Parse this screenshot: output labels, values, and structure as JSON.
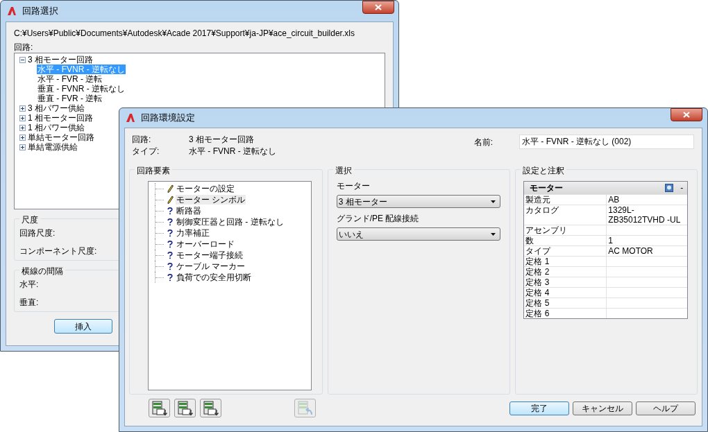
{
  "back_window": {
    "title": "回路選択",
    "path": "C:¥Users¥Public¥Documents¥Autodesk¥Acade 2017¥Support¥ja-JP¥ace_circuit_builder.xls",
    "tree_label": "回路:",
    "tree": [
      {
        "label": "3 相モーター回路",
        "expanded": true,
        "selected": false,
        "children": [
          {
            "label": "水平 - FVNR - 逆転なし",
            "selected": true
          },
          {
            "label": "水平 - FVR - 逆転",
            "selected": false
          },
          {
            "label": "垂直 - FVNR - 逆転なし",
            "selected": false
          },
          {
            "label": "垂直 - FVR - 逆転",
            "selected": false
          }
        ]
      },
      {
        "label": "3 相パワー供給",
        "expanded": false,
        "selected": false
      },
      {
        "label": "1 相モーター回路",
        "expanded": false,
        "selected": false
      },
      {
        "label": "1 相パワー供給",
        "expanded": false,
        "selected": false
      },
      {
        "label": "単結モーター回路",
        "expanded": false,
        "selected": false
      },
      {
        "label": "単結電源供給",
        "expanded": false,
        "selected": false
      }
    ],
    "groups": [
      {
        "title": "尺度",
        "labels": [
          "回路尺度:",
          "コンポーネント尺度:"
        ]
      },
      {
        "title": "横線の間隔",
        "labels": [
          "水平:",
          "垂直:"
        ]
      }
    ],
    "insert_button": "挿入"
  },
  "front_window": {
    "title": "回路環境設定",
    "info": [
      {
        "label": "回路:",
        "value": "3 相モーター回路"
      },
      {
        "label": "タイプ:",
        "value": "水平 - FVNR - 逆転なし"
      }
    ],
    "name_label": "名前:",
    "name_value": "水平 - FVNR - 逆転なし (002)",
    "elements_group": {
      "title": "回路要素",
      "items": [
        {
          "label": "モーターの設定",
          "kind": "pencil",
          "selected": false
        },
        {
          "label": "モーター シンボル",
          "kind": "pencil",
          "selected": true
        },
        {
          "label": "断路器",
          "kind": "question",
          "selected": false
        },
        {
          "label": "制御変圧器と回路 - 逆転なし",
          "kind": "question",
          "selected": false
        },
        {
          "label": "力率補正",
          "kind": "question",
          "selected": false
        },
        {
          "label": "オーバーロード",
          "kind": "question",
          "selected": false
        },
        {
          "label": "モーター端子接続",
          "kind": "question",
          "selected": false
        },
        {
          "label": "ケーブル マーカー",
          "kind": "question",
          "selected": false
        },
        {
          "label": "負荷での安全用切断",
          "kind": "question",
          "selected": false
        }
      ]
    },
    "selection_group": {
      "title": "選択",
      "fields": [
        {
          "label": "モーター",
          "value": "3 相モーター"
        },
        {
          "label": "グランド/PE 配線接続",
          "value": "いいえ"
        }
      ]
    },
    "settings_group": {
      "title": "設定と注釈",
      "grid_title": "モーター",
      "collapse": "-",
      "rows": [
        {
          "name": "製造元",
          "value": "AB"
        },
        {
          "name": "カタログ",
          "value": "1329L-ZB35012TVHD -UL"
        },
        {
          "name": "アセンブリ"
        },
        {
          "name": "数",
          "value": "1"
        },
        {
          "name": "タイプ",
          "value": "AC MOTOR"
        },
        {
          "name": "定格 1"
        },
        {
          "name": "定格 2"
        },
        {
          "name": "定格 3"
        },
        {
          "name": "定格 4"
        },
        {
          "name": "定格 5"
        },
        {
          "name": "定格 6"
        }
      ]
    },
    "icon_buttons": [
      {
        "kind": "list",
        "disabled": false
      },
      {
        "kind": "list",
        "disabled": false
      },
      {
        "kind": "list",
        "disabled": false
      },
      {
        "kind": "undo",
        "disabled": true
      }
    ],
    "buttons": [
      {
        "label": "完了",
        "default": true
      },
      {
        "label": "キャンセル",
        "default": false
      },
      {
        "label": "ヘルプ",
        "default": false
      }
    ]
  }
}
